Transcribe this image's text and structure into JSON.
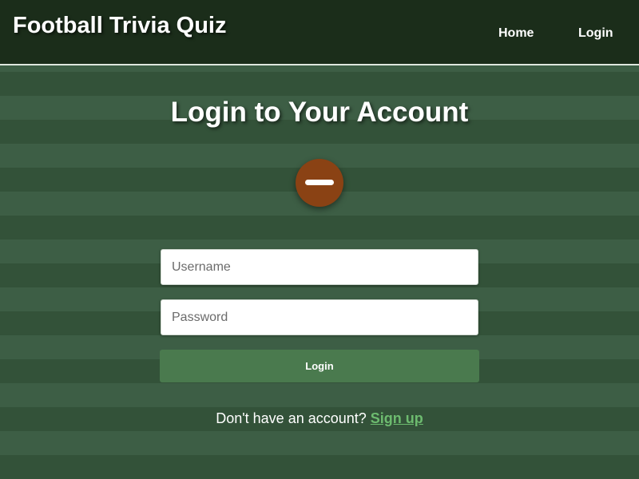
{
  "header": {
    "site_title": "Football Trivia Quiz",
    "nav": {
      "home_label": "Home",
      "login_label": "Login"
    }
  },
  "main": {
    "title": "Login to Your Account",
    "icon": "football-icon",
    "username_placeholder": "Username",
    "username_value": "",
    "password_placeholder": "Password",
    "password_value": "",
    "login_button_label": "Login",
    "signup_prompt": "Don't have an account?",
    "signup_link_label": "Sign up"
  },
  "colors": {
    "header_bg": "#1b2d1a",
    "stripe_light": "#3d5e45",
    "stripe_dark": "#335239",
    "button_bg": "#4a7a4e",
    "ball": "#8a4214",
    "link": "#6dbb6f"
  }
}
